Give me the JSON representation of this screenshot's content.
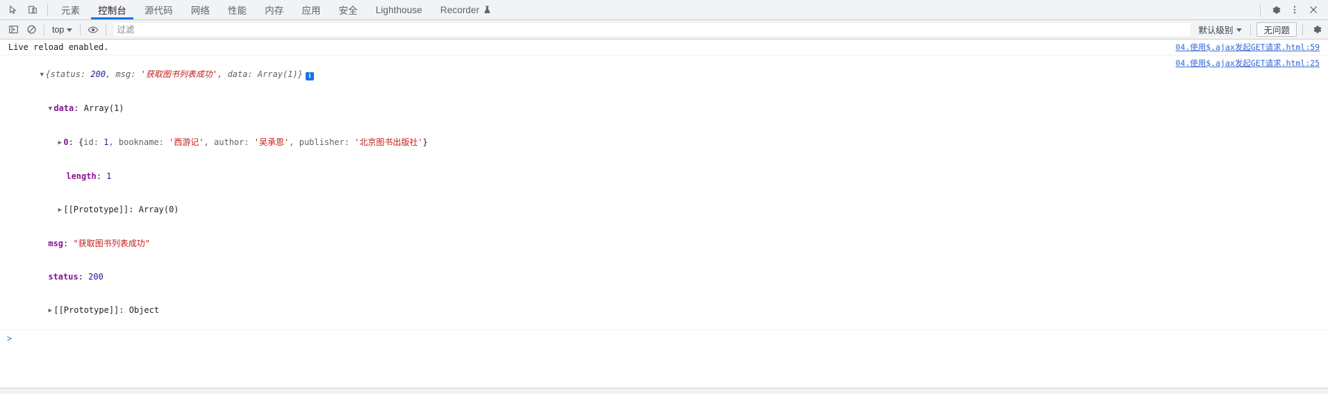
{
  "tabbar": {
    "inspect_icon": "inspect-cursor-icon",
    "device_icon": "device-toolbar-icon",
    "tabs": [
      {
        "label": "元素",
        "active": false
      },
      {
        "label": "控制台",
        "active": true
      },
      {
        "label": "源代码",
        "active": false
      },
      {
        "label": "网络",
        "active": false
      },
      {
        "label": "性能",
        "active": false
      },
      {
        "label": "内存",
        "active": false
      },
      {
        "label": "应用",
        "active": false
      },
      {
        "label": "安全",
        "active": false
      },
      {
        "label": "Lighthouse",
        "active": false
      },
      {
        "label": "Recorder",
        "active": false,
        "badge": "flask-icon"
      }
    ],
    "settings_icon": "gear-icon",
    "more_icon": "kebab-menu-icon",
    "close_icon": "close-icon",
    "accent_color": "#1a73e8"
  },
  "filterbar": {
    "sidebar_toggle_icon": "console-sidebar-icon",
    "clear_icon": "clear-console-icon",
    "context_value": "top",
    "eye_icon": "live-expression-icon",
    "filter_placeholder": "过滤",
    "filter_value": "",
    "levels_value": "默认级别",
    "issues_label": "无问题",
    "settings_icon": "gear-icon"
  },
  "console": {
    "rows": [
      {
        "type": "plain",
        "text": "Live reload enabled.",
        "source": "04.使用$.ajax发起GET请求.html:59"
      },
      {
        "type": "object",
        "source": "04.使用$.ajax发起GET请求.html:25",
        "preview": {
          "open_brace": "{",
          "status_key": "status: ",
          "status_val": "200",
          "sep1": ", ",
          "msg_key": "msg: ",
          "msg_val": "'获取图书列表成功'",
          "sep2": ", ",
          "data_key": "data: ",
          "data_val": "Array(1)",
          "close_brace": "}",
          "badge": "i"
        },
        "tree": [
          {
            "indent": 1,
            "arrow": "▼",
            "key": "data",
            "sep": ": ",
            "value": "Array(1)",
            "value_class": "plain"
          },
          {
            "indent": 2,
            "arrow": "▶",
            "key": "0",
            "sep": ": ",
            "value": "{id: 1, bookname: '西游记', author: '吴承恩', publisher: '北京图书出版社'}",
            "value_class": "inline-object"
          },
          {
            "indent": 3,
            "arrow": "",
            "key": "length",
            "sep": ": ",
            "value": "1",
            "value_class": "num"
          },
          {
            "indent": 2,
            "arrow": "▶",
            "key": "[[Prototype]]",
            "sep": ": ",
            "value": "Array(0)",
            "value_class": "plain-key"
          },
          {
            "indent": 1,
            "arrow": "",
            "key": "msg",
            "sep": ": ",
            "value": "\"获取图书列表成功\"",
            "value_class": "str"
          },
          {
            "indent": 1,
            "arrow": "",
            "key": "status",
            "sep": ": ",
            "value": "200",
            "value_class": "num"
          },
          {
            "indent": 1,
            "arrow": "▶",
            "key": "[[Prototype]]",
            "sep": ": ",
            "value": "Object",
            "value_class": "plain-key"
          }
        ]
      }
    ],
    "prompt_caret": ">",
    "prompt_value": ""
  },
  "inline_object_parts": {
    "open": "{",
    "id_key": "id: ",
    "id_val": "1",
    "c1": ", ",
    "bookname_key": "bookname: ",
    "bookname_val": "'西游记'",
    "c2": ", ",
    "author_key": "author: ",
    "author_val": "'吴承恩'",
    "c3": ", ",
    "publisher_key": "publisher: ",
    "publisher_val": "'北京图书出版社'",
    "close": "}"
  }
}
